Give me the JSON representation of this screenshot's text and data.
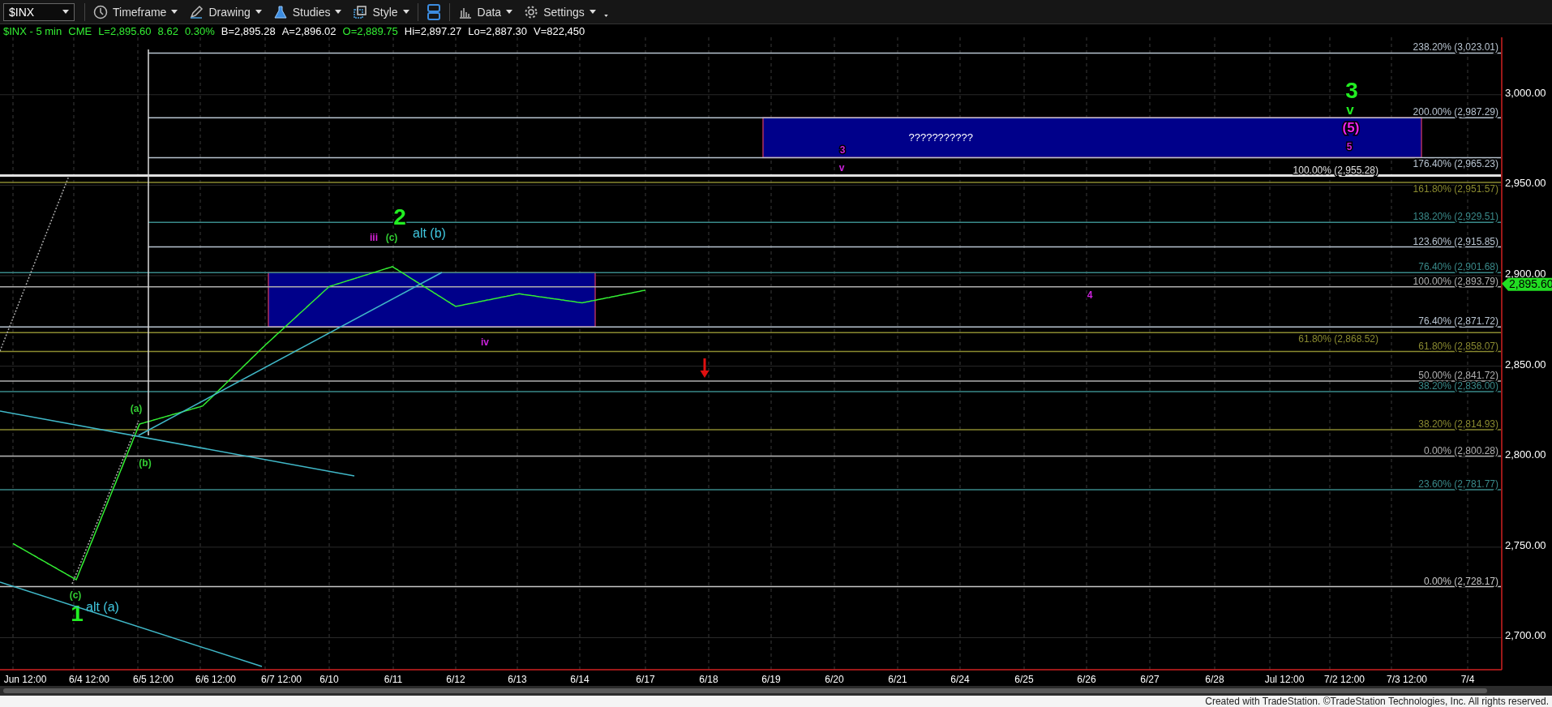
{
  "toolbar": {
    "symbol": "$INX",
    "items": [
      {
        "kind": "timeframe",
        "label": "Timeframe"
      },
      {
        "kind": "drawing",
        "label": "Drawing"
      },
      {
        "kind": "studies",
        "label": "Studies"
      },
      {
        "kind": "style",
        "label": "Style"
      },
      {
        "kind": "layout"
      },
      {
        "kind": "data",
        "label": "Data"
      },
      {
        "kind": "settings",
        "label": "Settings"
      }
    ]
  },
  "quote_bar": [
    {
      "text": "$INX - 5 min",
      "color": "#33ee33"
    },
    {
      "text": "CME",
      "color": "#33ee33"
    },
    {
      "text": "L=2,895.60",
      "color": "#33ee33"
    },
    {
      "text": "8.62",
      "color": "#33ee33"
    },
    {
      "text": "0.30%",
      "color": "#33ee33"
    },
    {
      "text": "B=2,895.28",
      "color": "#ffffff"
    },
    {
      "text": "A=2,896.02",
      "color": "#ffffff"
    },
    {
      "text": "O=2,889.75",
      "color": "#33ee33"
    },
    {
      "text": "Hi=2,897.27",
      "color": "#ffffff"
    },
    {
      "text": "Lo=2,887.30",
      "color": "#ffffff"
    },
    {
      "text": "V=822,450",
      "color": "#ffffff"
    }
  ],
  "chart": {
    "chart_data": {
      "type": "line",
      "grid": true,
      "categories": [
        "Jun 12:00",
        "6/4 12:00",
        "6/5 12:00",
        "6/6 12:00",
        "6/7 12:00",
        "6/10",
        "6/11",
        "6/12",
        "6/13",
        "6/14",
        "6/17",
        "6/18",
        "6/19",
        "6/20",
        "6/21",
        "6/24",
        "6/25",
        "6/26",
        "6/27",
        "6/28",
        "Jul 12:00",
        "7/2 12:00",
        "7/3 12:00",
        "7/4"
      ],
      "ylim": [
        2682.3,
        3031.7
      ],
      "yticks": [
        {
          "value": 2700,
          "label": "2,700.00"
        },
        {
          "value": 2750,
          "label": "2,750.00"
        },
        {
          "value": 2800,
          "label": "2,800.00"
        },
        {
          "value": 2850,
          "label": "2,850.00"
        },
        {
          "value": 2900,
          "label": "2,900.00"
        },
        {
          "value": 2950,
          "label": "2,950.00"
        },
        {
          "value": 3000,
          "label": "3,000.00"
        }
      ],
      "series": [
        {
          "color": "#33ee33",
          "values": [
            2752,
            2732,
            2818,
            2828,
            2862,
            2894,
            2905,
            2883,
            2890,
            2885,
            2892,
            null,
            null,
            null,
            null,
            null,
            null,
            null,
            null,
            null,
            null,
            null,
            null,
            null
          ]
        }
      ],
      "bands": [
        {
          "axis": "y",
          "from": 2871.72,
          "to": 2901.68,
          "color": "#00008a"
        },
        {
          "axis": "y",
          "from": 2965.23,
          "to": 2987.29,
          "color": "#00008a",
          "label": "???????????"
        }
      ],
      "ref_lines": [
        {
          "axis": "y",
          "value": 3023.01,
          "label": "238.20% (3,023.01)",
          "color": "#b8c4d0"
        },
        {
          "axis": "y",
          "value": 2987.29,
          "label": "200.00% (2,987.29)",
          "color": "#b8c4d0"
        },
        {
          "axis": "y",
          "value": 2965.23,
          "label": "176.40% (2,965.23)",
          "color": "#b8c4d0"
        },
        {
          "axis": "y",
          "value": 2955.28,
          "label": "100.00% (2,955.28)",
          "color": "#e0e0e0"
        },
        {
          "axis": "y",
          "value": 2951.57,
          "label": "161.80% (2,951.57)",
          "color": "#8a8a30"
        },
        {
          "axis": "y",
          "value": 2929.51,
          "label": "138.20% (2,929.51)",
          "color": "#3a8a8a"
        },
        {
          "axis": "y",
          "value": 2915.85,
          "label": "123.60% (2,915.85)",
          "color": "#b8c4d0"
        },
        {
          "axis": "y",
          "value": 2901.68,
          "label": "76.40% (2,901.68)",
          "color": "#3a8a8a"
        },
        {
          "axis": "y",
          "value": 2893.79,
          "label": "100.00% (2,893.79)",
          "color": "#b0b0b0"
        },
        {
          "axis": "y",
          "value": 2871.72,
          "label": "76.40% (2,871.72)",
          "color": "#b8c4d0"
        },
        {
          "axis": "y",
          "value": 2868.52,
          "label": "61.80% (2,868.52)",
          "color": "#8a8a30"
        },
        {
          "axis": "y",
          "value": 2858.07,
          "label": "61.80% (2,858.07)",
          "color": "#8a8a30"
        },
        {
          "axis": "y",
          "value": 2841.72,
          "label": "50.00% (2,841.72)",
          "color": "#b0b0b0"
        },
        {
          "axis": "y",
          "value": 2836.0,
          "label": "38.20% (2,836.00)",
          "color": "#3a8a8a"
        },
        {
          "axis": "y",
          "value": 2814.93,
          "label": "38.20% (2,814.93)",
          "color": "#8a8a30"
        },
        {
          "axis": "y",
          "value": 2800.28,
          "label": "0.00% (2,800.28)",
          "color": "#b0b0b0"
        },
        {
          "axis": "y",
          "value": 2781.77,
          "label": "23.60% (2,781.77)",
          "color": "#3a8a8a"
        },
        {
          "axis": "y",
          "value": 2728.17,
          "label": "0.00% (2,728.17)",
          "color": "#c8c8c8"
        }
      ]
    },
    "last_price": "2,895.60",
    "wave_labels": [
      {
        "text": "3",
        "kind": "major",
        "color": "#22ee22"
      },
      {
        "text": "v",
        "kind": "wave",
        "color": "#22ee22"
      },
      {
        "text": "(5)",
        "kind": "wave",
        "color": "#ee22ee"
      },
      {
        "text": "5",
        "kind": "minor",
        "color": "#cc22dd"
      },
      {
        "text": "3",
        "kind": "minor",
        "color": "#cc22dd"
      },
      {
        "text": "v",
        "kind": "minor",
        "color": "#cc22dd"
      },
      {
        "text": "2",
        "kind": "major",
        "color": "#22ee22"
      },
      {
        "text": "iii",
        "kind": "minor",
        "color": "#dd22dd"
      },
      {
        "text": "(c)",
        "kind": "minor",
        "color": "#33cc33"
      },
      {
        "text": "alt (b)",
        "kind": "alt",
        "color": "#40c8e0"
      },
      {
        "text": "4",
        "kind": "minor",
        "color": "#cc22dd"
      },
      {
        "text": "iv",
        "kind": "minor",
        "color": "#cc22dd"
      },
      {
        "text": "(a)",
        "kind": "minor",
        "color": "#33cc33"
      },
      {
        "text": "(b)",
        "kind": "minor",
        "color": "#33cc33"
      },
      {
        "text": "(c)",
        "kind": "minor",
        "color": "#33cc33"
      },
      {
        "text": "1",
        "kind": "major",
        "color": "#22ee22"
      },
      {
        "text": "alt (a)",
        "kind": "alt",
        "color": "#40c8e0"
      }
    ]
  },
  "footer_note": "Created with TradeStation. ©TradeStation Technologies, Inc. All rights reserved."
}
